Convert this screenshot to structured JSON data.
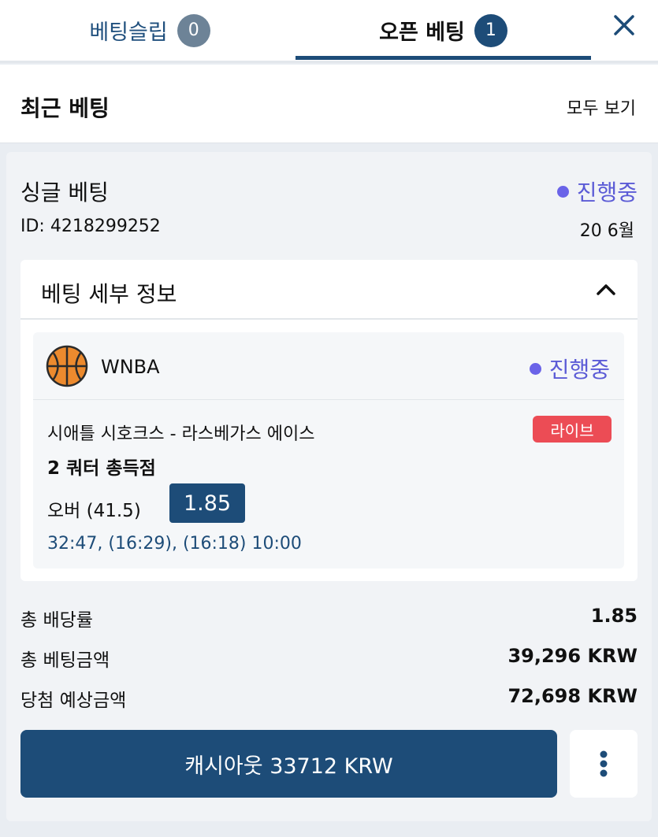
{
  "tabs": {
    "betslip": {
      "label": "베팅슬립",
      "count": "0"
    },
    "open_bets": {
      "label": "오픈 베팅",
      "count": "1"
    }
  },
  "icons": {
    "close": "close-icon",
    "chevron": "chevron-up-icon",
    "sport": "basketball-icon",
    "more": "more-vertical-icon"
  },
  "colors": {
    "brand": "#1d4c78",
    "status": "#5b5bd6",
    "live": "#ec4c55"
  },
  "section": {
    "title": "최근 베팅",
    "view_all": "모두 보기"
  },
  "bet": {
    "type": "싱글 베팅",
    "status": "진행중",
    "id_label": "ID: 4218299252",
    "date": "20 6월",
    "details_title": "베팅 세부 정보",
    "selection": {
      "league": "WNBA",
      "status": "진행중",
      "match": "시애틀 시호크스 - 라스베가스 에이스",
      "live_label": "라이브",
      "market": "2 쿼터 총득점",
      "pick": "오버 (41.5)",
      "odds": "1.85",
      "time": "32:47, (16:29), (16:18) 10:00"
    },
    "summary": [
      {
        "label": "총 배당률",
        "value": "1.85"
      },
      {
        "label": "총 베팅금액",
        "value": "39,296 KRW"
      },
      {
        "label": "당첨 예상금액",
        "value": "72,698 KRW"
      }
    ],
    "cashout_label": "캐시아웃 33712 KRW"
  }
}
